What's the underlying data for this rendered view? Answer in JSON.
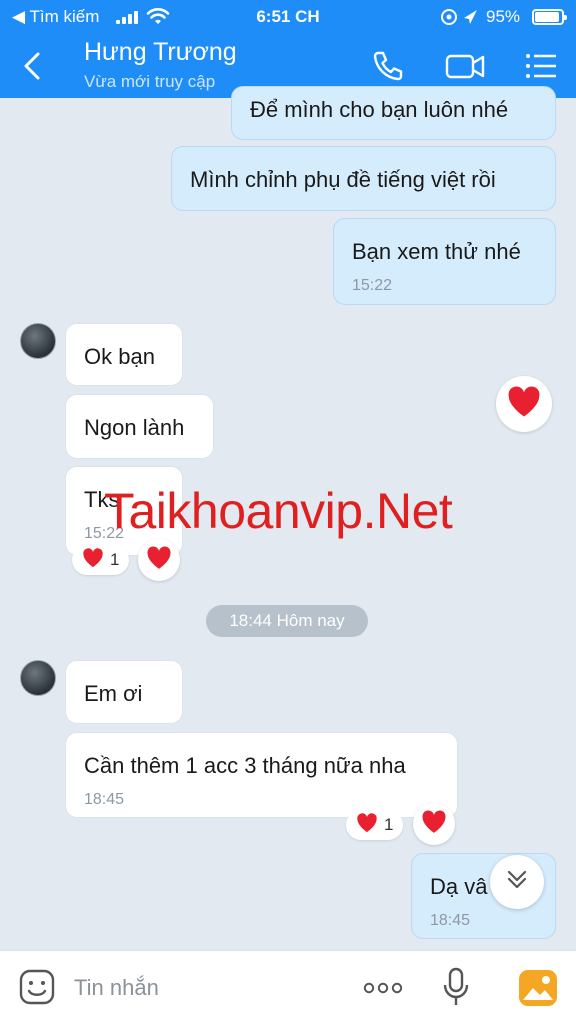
{
  "status_bar": {
    "back_label": "◀ Tìm kiếm",
    "time": "6:51 CH",
    "battery": "95%"
  },
  "header": {
    "contact_name": "Hưng Trương",
    "contact_status": "Vừa mới truy cập",
    "icons": [
      "back-icon",
      "phone-icon",
      "video-icon",
      "menu-icon"
    ]
  },
  "messages": [
    {
      "text": "Để mình cho bạn luôn nhé"
    },
    {
      "text": "Mình chỉnh phụ đề tiếng việt rồi"
    },
    {
      "text": "Bạn xem thử nhé",
      "time": "15:22"
    },
    {
      "text": "Ok bạn"
    },
    {
      "text": "Ngon lành"
    },
    {
      "text": "Tks",
      "time": "15:22",
      "reaction_count": "1"
    },
    {
      "text": "Em ơi"
    },
    {
      "text": "Cần thêm 1 acc 3 tháng nữa nha",
      "time": "18:45",
      "reaction_count": "1"
    },
    {
      "text": "Dạ vâ",
      "time": "18:45"
    }
  ],
  "divider": {
    "label": "18:44 Hôm nay"
  },
  "watermark": "Taikhoanvip.Net",
  "input": {
    "placeholder": "Tin nhắn"
  },
  "colors": {
    "header": "#1f8df7",
    "mine_bubble": "#d5ecfc",
    "heart": "#e8202f",
    "background": "#e2e9f1"
  }
}
